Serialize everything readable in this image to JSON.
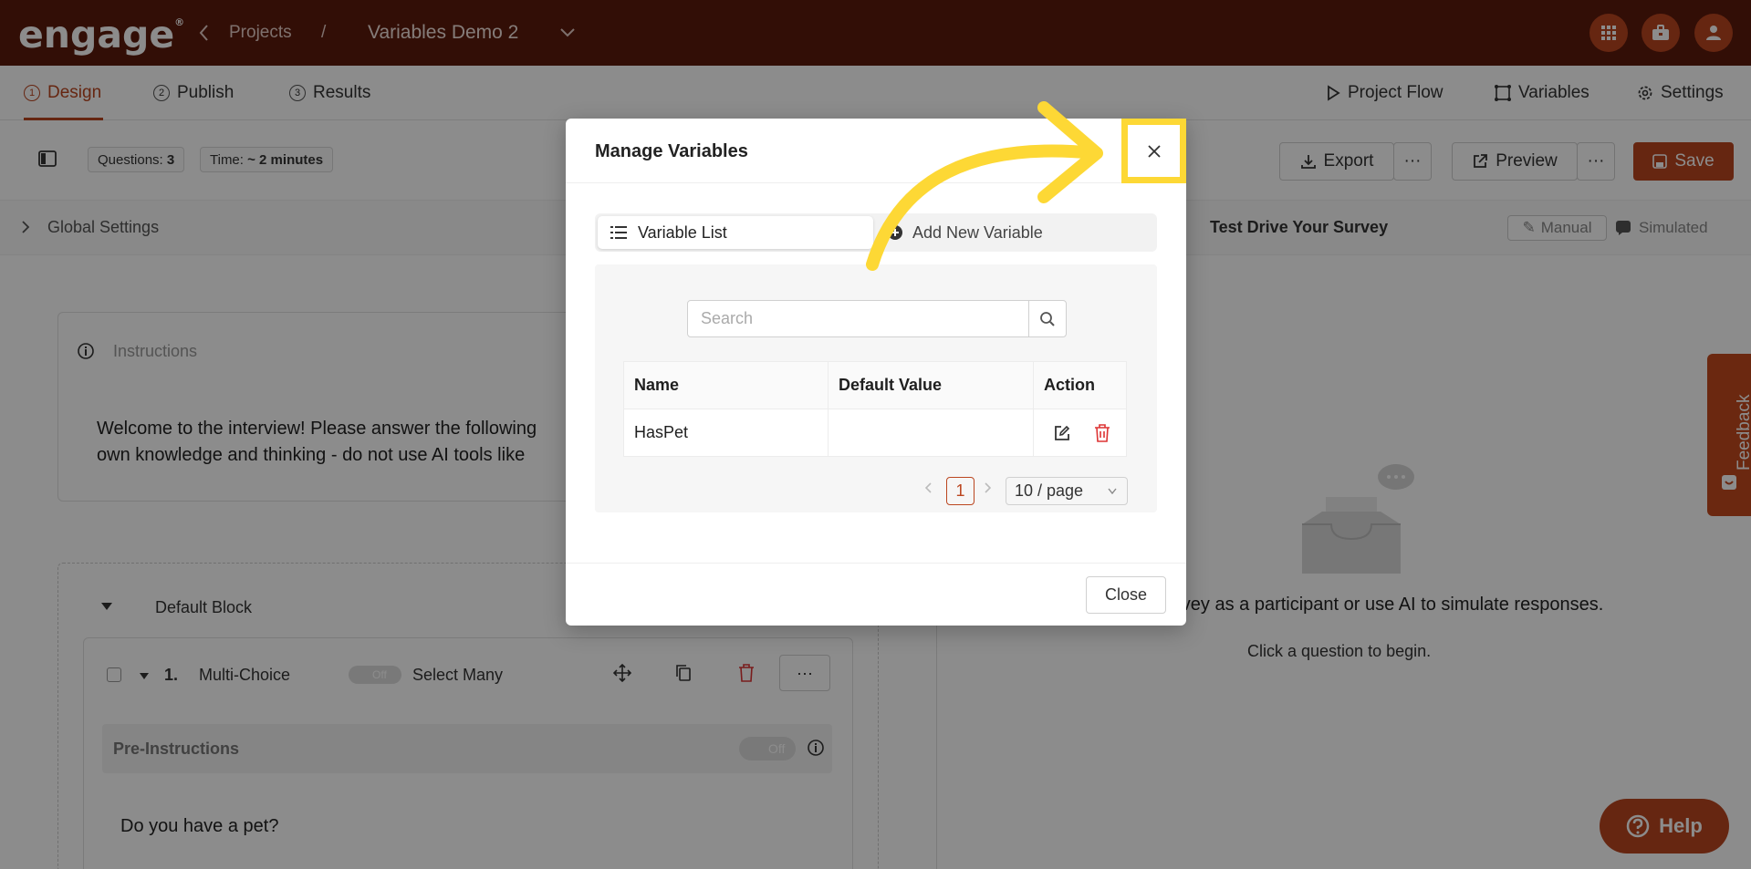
{
  "app": {
    "logo": "engage",
    "logo_mark": "®"
  },
  "topbar": {
    "back_label": "Projects",
    "separator": "/",
    "project_title": "Variables Demo 2",
    "icons": [
      "apps-grid-icon",
      "briefcase-icon",
      "user-icon"
    ]
  },
  "tabs": [
    {
      "num": "1",
      "label": "Design",
      "active": true
    },
    {
      "num": "2",
      "label": "Publish"
    },
    {
      "num": "3",
      "label": "Results"
    }
  ],
  "right_tabs": {
    "project_flow": "Project Flow",
    "variables": "Variables",
    "settings": "Settings"
  },
  "toolbar": {
    "questions_label": "Questions:",
    "questions_value": "3",
    "time_label": "Time:",
    "time_value": "~ 2 minutes",
    "export": "Export",
    "preview": "Preview",
    "save": "Save"
  },
  "global_settings": "Global Settings",
  "instructions": {
    "label": "Instructions",
    "text_line1": "Welcome to the interview! Please answer the following",
    "text_line2": "own knowledge and thinking - do not use AI tools like"
  },
  "block": {
    "title": "Default Block",
    "q_num": "1.",
    "q_type": "Multi-Choice",
    "toggle": "Off",
    "select_many": "Select Many",
    "pre_instructions": "Pre-Instructions",
    "pre_toggle": "Off",
    "question_text": "Do you have a pet?"
  },
  "test_drive": {
    "title": "Test Drive Your Survey",
    "manual": "Manual",
    "simulated": "Simulated",
    "desc": "urvey as a participant or use AI to simulate responses.",
    "hint": "Click a question to begin."
  },
  "feedback": "Feedback",
  "help": "Help",
  "modal": {
    "title": "Manage Variables",
    "seg_list": "Variable List",
    "seg_add": "Add New Variable",
    "search_placeholder": "Search",
    "columns": [
      "Name",
      "Default Value",
      "Action"
    ],
    "rows": [
      {
        "name": "HasPet",
        "default_value": ""
      }
    ],
    "page": "1",
    "page_size": "10 / page",
    "close_button": "Close"
  },
  "colors": {
    "brand_dark": "#5c1a0b",
    "brand": "#bb4620",
    "highlight": "#fdd835"
  }
}
